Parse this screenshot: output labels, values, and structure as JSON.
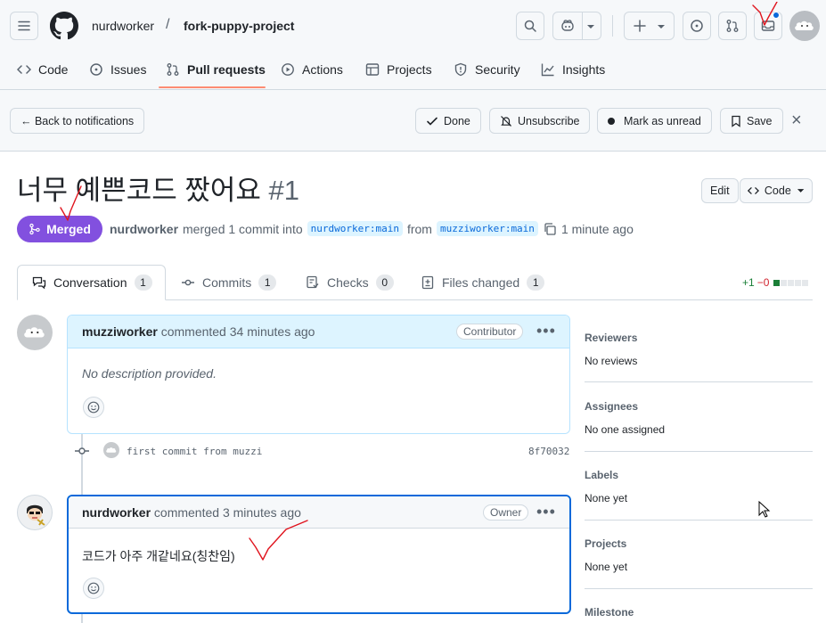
{
  "header": {
    "owner": "nurdworker",
    "separator": "/",
    "repo": "fork-puppy-project"
  },
  "repo_nav": [
    {
      "label": "Code",
      "icon": "code-icon"
    },
    {
      "label": "Issues",
      "icon": "issue-icon"
    },
    {
      "label": "Pull requests",
      "icon": "pull-request-icon",
      "selected": true
    },
    {
      "label": "Actions",
      "icon": "play-icon"
    },
    {
      "label": "Projects",
      "icon": "table-icon"
    },
    {
      "label": "Security",
      "icon": "shield-icon"
    },
    {
      "label": "Insights",
      "icon": "graph-icon"
    }
  ],
  "notifications_bar": {
    "back": "← Back to notifications",
    "done": "Done",
    "unsubscribe": "Unsubscribe",
    "mark_unread": "Mark as unread",
    "save": "Save",
    "close": "×"
  },
  "pr": {
    "title": "너무 예쁜코드 짰어요",
    "number": "#1",
    "edit": "Edit",
    "code": "Code",
    "state": "Merged",
    "author": "nurdworker",
    "merged_text": "merged 1 commit into",
    "base": "nurdworker:main",
    "from_text": "from",
    "head": "muzziworker:main",
    "time": "1 minute ago"
  },
  "tabs": [
    {
      "label": "Conversation",
      "count": "1"
    },
    {
      "label": "Commits",
      "count": "1"
    },
    {
      "label": "Checks",
      "count": "0"
    },
    {
      "label": "Files changed",
      "count": "1"
    }
  ],
  "diffstat": {
    "added": "+1",
    "removed": "−0"
  },
  "comments": [
    {
      "author": "muzziworker",
      "action": "commented 34 minutes ago",
      "role": "Contributor",
      "body": "No description provided."
    },
    {
      "author": "nurdworker",
      "action": "commented 3 minutes ago",
      "role": "Owner",
      "body": "코드가 아주 개같네요(칭찬임)"
    }
  ],
  "commit": {
    "message": "first commit from muzzi",
    "sha": "8f70032"
  },
  "sidebar": [
    {
      "heading": "Reviewers",
      "value": "No reviews"
    },
    {
      "heading": "Assignees",
      "value": "No one assigned"
    },
    {
      "heading": "Labels",
      "value": "None yet"
    },
    {
      "heading": "Projects",
      "value": "None yet"
    },
    {
      "heading": "Milestone",
      "value": ""
    }
  ],
  "colors": {
    "merged": "#8250df",
    "accent": "#fd8c73",
    "link_bg": "#ddf4ff",
    "link": "#0969da",
    "annotation": "#e0141e",
    "comment_header_bg": "#ddf4ff"
  }
}
